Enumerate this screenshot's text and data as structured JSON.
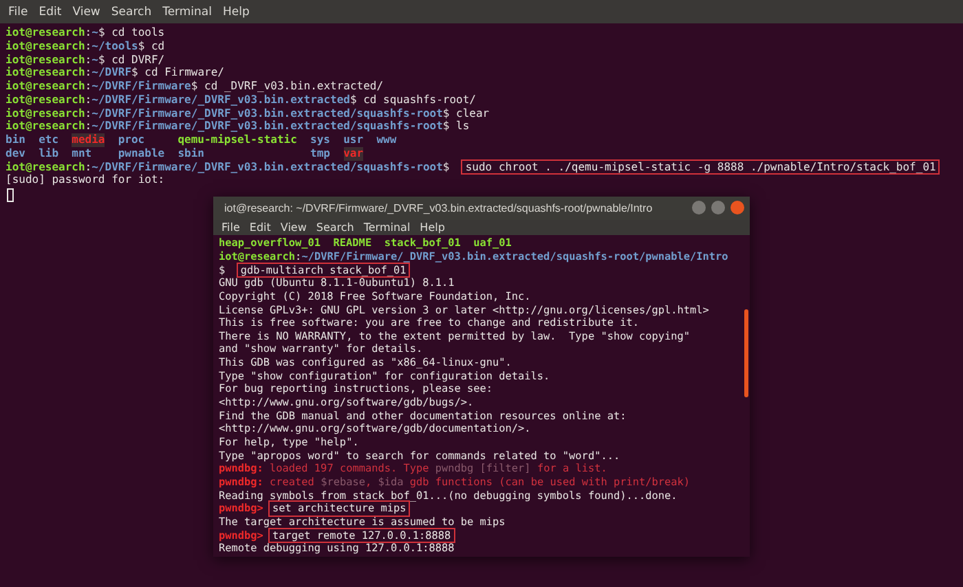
{
  "terminal": {
    "menu": [
      "File",
      "Edit",
      "View",
      "Search",
      "Terminal",
      "Help"
    ],
    "lines": [
      {
        "kind": "text",
        "segments": [
          {
            "kind": "user",
            "text": "iot@research"
          },
          {
            "kind": "plain",
            "text": ":"
          },
          {
            "kind": "path",
            "text": "~"
          },
          {
            "kind": "plain",
            "text": "$ cd tools"
          }
        ]
      },
      {
        "kind": "text",
        "segments": [
          {
            "kind": "user",
            "text": "iot@research"
          },
          {
            "kind": "plain",
            "text": ":"
          },
          {
            "kind": "path",
            "text": "~/tools"
          },
          {
            "kind": "plain",
            "text": "$ cd"
          }
        ]
      },
      {
        "kind": "text",
        "segments": [
          {
            "kind": "user",
            "text": "iot@research"
          },
          {
            "kind": "plain",
            "text": ":"
          },
          {
            "kind": "path",
            "text": "~"
          },
          {
            "kind": "plain",
            "text": "$ cd DVRF/"
          }
        ]
      },
      {
        "kind": "text",
        "segments": [
          {
            "kind": "user",
            "text": "iot@research"
          },
          {
            "kind": "plain",
            "text": ":"
          },
          {
            "kind": "path",
            "text": "~/DVRF"
          },
          {
            "kind": "plain",
            "text": "$ cd Firmware/"
          }
        ]
      },
      {
        "kind": "text",
        "segments": [
          {
            "kind": "user",
            "text": "iot@research"
          },
          {
            "kind": "plain",
            "text": ":"
          },
          {
            "kind": "path",
            "text": "~/DVRF/Firmware"
          },
          {
            "kind": "plain",
            "text": "$ cd _DVRF_v03.bin.extracted/"
          }
        ]
      },
      {
        "kind": "text",
        "segments": [
          {
            "kind": "user",
            "text": "iot@research"
          },
          {
            "kind": "plain",
            "text": ":"
          },
          {
            "kind": "path",
            "text": "~/DVRF/Firmware/_DVRF_v03.bin.extracted"
          },
          {
            "kind": "plain",
            "text": "$ cd squashfs-root/"
          }
        ]
      },
      {
        "kind": "text",
        "segments": [
          {
            "kind": "user",
            "text": "iot@research"
          },
          {
            "kind": "plain",
            "text": ":"
          },
          {
            "kind": "path",
            "text": "~/DVRF/Firmware/_DVRF_v03.bin.extracted/squashfs-root"
          },
          {
            "kind": "plain",
            "text": "$ clear"
          }
        ]
      },
      {
        "kind": "text",
        "segments": [
          {
            "kind": "user",
            "text": "iot@research"
          },
          {
            "kind": "plain",
            "text": ":"
          },
          {
            "kind": "path",
            "text": "~/DVRF/Firmware/_DVRF_v03.bin.extracted/squashfs-root"
          },
          {
            "kind": "plain",
            "text": "$ ls"
          }
        ]
      },
      {
        "kind": "listing",
        "segments": [
          {
            "kind": "dir",
            "text": "bin"
          },
          {
            "kind": "dir",
            "text": "etc"
          },
          {
            "kind": "special",
            "text": "media"
          },
          {
            "kind": "dir",
            "text": "proc"
          },
          {
            "kind": "exec",
            "text": "qemu-mipsel-static"
          },
          {
            "kind": "dir",
            "text": "sys"
          },
          {
            "kind": "dir",
            "text": "usr"
          },
          {
            "kind": "dir",
            "text": "www"
          }
        ]
      },
      {
        "kind": "listing",
        "segments": [
          {
            "kind": "dir",
            "text": "dev"
          },
          {
            "kind": "dir",
            "text": "lib"
          },
          {
            "kind": "dir",
            "text": "mnt"
          },
          {
            "kind": "dir",
            "text": "pwnable"
          },
          {
            "kind": "dir",
            "text": "sbin"
          },
          {
            "kind": "dir",
            "text": "tmp"
          },
          {
            "kind": "special",
            "text": "var"
          }
        ]
      },
      {
        "kind": "text",
        "segments": [
          {
            "kind": "user",
            "text": "iot@research"
          },
          {
            "kind": "plain",
            "text": ":"
          },
          {
            "kind": "path",
            "text": "~/DVRF/Firmware/_DVRF_v03.bin.extracted/squashfs-root"
          },
          {
            "kind": "plain",
            "text": "$ "
          },
          {
            "kind": "boxed",
            "text": "sudo chroot . ./qemu-mipsel-static -g 8888 ./pwnable/Intro/stack_bof_01"
          }
        ]
      },
      {
        "kind": "text",
        "segments": [
          {
            "kind": "plain",
            "text": "[sudo] password for iot:"
          }
        ]
      }
    ]
  },
  "gdb_window": {
    "title": "iot@research: ~/DVRF/Firmware/_DVRF_v03.bin.extracted/squashfs-root/pwnable/Intro",
    "menu": [
      "File",
      "Edit",
      "View",
      "Search",
      "Terminal",
      "Help"
    ],
    "lines": [
      {
        "kind": "listing",
        "segments": [
          {
            "kind": "exec",
            "text": "heap_overflow_01"
          },
          {
            "kind": "exec",
            "text": "README"
          },
          {
            "kind": "exec",
            "text": "stack_bof_01"
          },
          {
            "kind": "exec",
            "text": "uaf_01"
          }
        ]
      },
      {
        "kind": "text",
        "segments": [
          {
            "kind": "user",
            "text": "iot@research"
          },
          {
            "kind": "plain",
            "text": ":"
          },
          {
            "kind": "path",
            "text": "~/DVRF/Firmware/_DVRF_v03.bin.extracted/squashfs-root/pwnable/Intro"
          }
        ]
      },
      {
        "kind": "text",
        "segments": [
          {
            "kind": "plain",
            "text": "$ "
          },
          {
            "kind": "boxed",
            "text": "gdb-multiarch stack_bof_01"
          }
        ]
      },
      {
        "kind": "text",
        "segments": [
          {
            "kind": "plain",
            "text": "GNU gdb (Ubuntu 8.1.1-0ubuntu1) 8.1.1"
          }
        ]
      },
      {
        "kind": "text",
        "segments": [
          {
            "kind": "plain",
            "text": "Copyright (C) 2018 Free Software Foundation, Inc."
          }
        ]
      },
      {
        "kind": "text",
        "segments": [
          {
            "kind": "plain",
            "text": "License GPLv3+: GNU GPL version 3 or later <http://gnu.org/licenses/gpl.html>"
          }
        ]
      },
      {
        "kind": "text",
        "segments": [
          {
            "kind": "plain",
            "text": "This is free software: you are free to change and redistribute it."
          }
        ]
      },
      {
        "kind": "text",
        "segments": [
          {
            "kind": "plain",
            "text": "There is NO WARRANTY, to the extent permitted by law.  Type \"show copying\""
          }
        ]
      },
      {
        "kind": "text",
        "segments": [
          {
            "kind": "plain",
            "text": "and \"show warranty\" for details."
          }
        ]
      },
      {
        "kind": "text",
        "segments": [
          {
            "kind": "plain",
            "text": "This GDB was configured as \"x86_64-linux-gnu\"."
          }
        ]
      },
      {
        "kind": "text",
        "segments": [
          {
            "kind": "plain",
            "text": "Type \"show configuration\" for configuration details."
          }
        ]
      },
      {
        "kind": "text",
        "segments": [
          {
            "kind": "plain",
            "text": "For bug reporting instructions, please see:"
          }
        ]
      },
      {
        "kind": "text",
        "segments": [
          {
            "kind": "plain",
            "text": "<http://www.gnu.org/software/gdb/bugs/>."
          }
        ]
      },
      {
        "kind": "text",
        "segments": [
          {
            "kind": "plain",
            "text": "Find the GDB manual and other documentation resources online at:"
          }
        ]
      },
      {
        "kind": "text",
        "segments": [
          {
            "kind": "plain",
            "text": "<http://www.gnu.org/software/gdb/documentation/>."
          }
        ]
      },
      {
        "kind": "text",
        "segments": [
          {
            "kind": "plain",
            "text": "For help, type \"help\"."
          }
        ]
      },
      {
        "kind": "text",
        "segments": [
          {
            "kind": "plain",
            "text": "Type \"apropos word\" to search for commands related to \"word\"..."
          }
        ]
      },
      {
        "kind": "text",
        "segments": [
          {
            "kind": "pwndbg",
            "text": "pwndbg:"
          },
          {
            "kind": "message",
            "text": " loaded 197 commands. Type "
          },
          {
            "kind": "dim",
            "text": "pwndbg [filter]"
          },
          {
            "kind": "message",
            "text": " for a list."
          }
        ]
      },
      {
        "kind": "text",
        "segments": [
          {
            "kind": "pwndbg",
            "text": "pwndbg:"
          },
          {
            "kind": "message",
            "text": " created "
          },
          {
            "kind": "dim",
            "text": "$rebase"
          },
          {
            "kind": "message",
            "text": ", "
          },
          {
            "kind": "dim",
            "text": "$ida"
          },
          {
            "kind": "message",
            "text": " gdb functions (can be used with print/break)"
          }
        ]
      },
      {
        "kind": "text",
        "segments": [
          {
            "kind": "plain",
            "text": "Reading symbols from stack_bof_01...(no debugging symbols found)...done."
          }
        ]
      },
      {
        "kind": "text",
        "segments": [
          {
            "kind": "pwndbg",
            "text": "pwndbg>"
          },
          {
            "kind": "boxed",
            "text": "set architecture mips"
          }
        ]
      },
      {
        "kind": "text",
        "segments": [
          {
            "kind": "plain",
            "text": "The target architecture is assumed to be mips"
          }
        ]
      },
      {
        "kind": "text",
        "segments": [
          {
            "kind": "pwndbg",
            "text": "pwndbg>"
          },
          {
            "kind": "boxed",
            "text": "target remote 127.0.0.1:8888"
          }
        ]
      },
      {
        "kind": "text",
        "segments": [
          {
            "kind": "plain",
            "text": "Remote debugging using 127.0.0.1:8888"
          }
        ]
      }
    ]
  }
}
